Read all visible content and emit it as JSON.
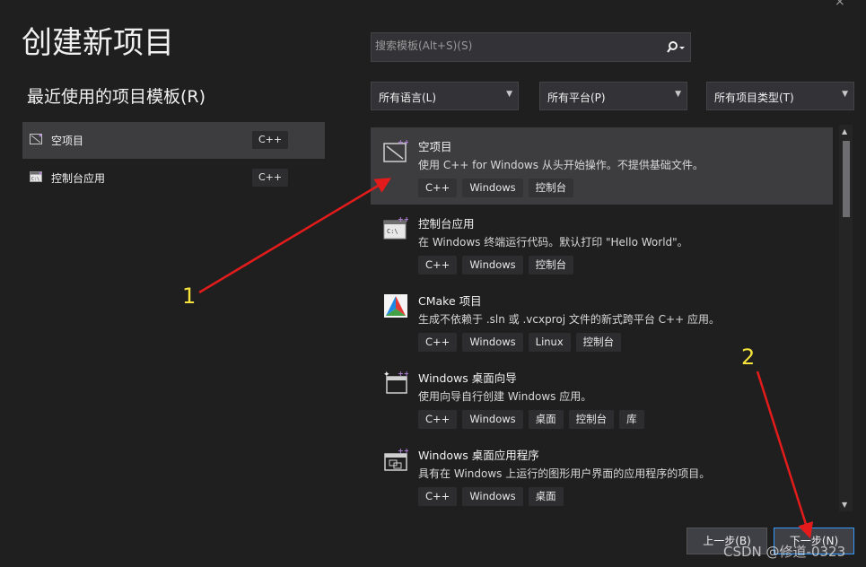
{
  "window": {
    "title": "创建新项目",
    "close_glyph": "×"
  },
  "recent": {
    "heading": "最近使用的项目模板(R)",
    "items": [
      {
        "label": "空项目",
        "tag": "C++",
        "icon": "empty-project-icon"
      },
      {
        "label": "控制台应用",
        "tag": "C++",
        "icon": "console-app-icon"
      }
    ]
  },
  "search": {
    "placeholder": "搜索模板(Alt+S)(S)",
    "icon": "search-icon"
  },
  "filters": {
    "language": "所有语言(L)",
    "platform": "所有平台(P)",
    "project_type": "所有项目类型(T)"
  },
  "templates": [
    {
      "name": "空项目",
      "description": "使用 C++ for Windows 从头开始操作。不提供基础文件。",
      "tags": [
        "C++",
        "Windows",
        "控制台"
      ],
      "icon": "empty-project-icon"
    },
    {
      "name": "控制台应用",
      "description": "在 Windows 终端运行代码。默认打印 \"Hello World\"。",
      "tags": [
        "C++",
        "Windows",
        "控制台"
      ],
      "icon": "console-app-icon"
    },
    {
      "name": "CMake 项目",
      "description": "生成不依赖于 .sln 或 .vcxproj 文件的新式跨平台 C++ 应用。",
      "tags": [
        "C++",
        "Windows",
        "Linux",
        "控制台"
      ],
      "icon": "cmake-icon"
    },
    {
      "name": "Windows 桌面向导",
      "description": "使用向导自行创建 Windows 应用。",
      "tags": [
        "C++",
        "Windows",
        "桌面",
        "控制台",
        "库"
      ],
      "icon": "desktop-wizard-icon"
    },
    {
      "name": "Windows 桌面应用程序",
      "description": "具有在 Windows 上运行的图形用户界面的应用程序的项目。",
      "tags": [
        "C++",
        "Windows",
        "桌面"
      ],
      "icon": "desktop-app-icon"
    }
  ],
  "footer": {
    "back": "上一步(B)",
    "next": "下一步(N)"
  },
  "annotations": {
    "one": "1",
    "two": "2"
  },
  "watermark": "CSDN @修道-0323",
  "colors": {
    "background": "#1f1f1f",
    "selected": "#3d3d40",
    "accent": "#3399ff",
    "annotation_arrow": "#e31b1b",
    "annotation_text": "#f5e23a"
  }
}
